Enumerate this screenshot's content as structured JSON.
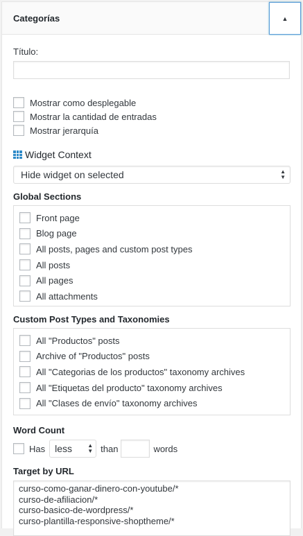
{
  "widget": {
    "title": "Categorías",
    "toggle_glyph": "▲"
  },
  "form": {
    "title_label": "Título:",
    "title_value": "",
    "options": [
      {
        "label": "Mostrar como desplegable",
        "checked": false
      },
      {
        "label": "Mostrar la cantidad de entradas",
        "checked": false
      },
      {
        "label": "Mostrar jerarquía",
        "checked": false
      }
    ]
  },
  "widget_context": {
    "heading": "Widget Context",
    "icon": "grid-table-icon",
    "icon_color": "#2e8ac8",
    "visibility_select": "Hide widget on selected",
    "global_sections": {
      "heading": "Global Sections",
      "items": [
        "Front page",
        "Blog page",
        "All posts, pages and custom post types",
        "All posts",
        "All pages",
        "All attachments"
      ]
    },
    "custom_types": {
      "heading": "Custom Post Types and Taxonomies",
      "items": [
        "All \"Productos\" posts",
        "Archive of \"Productos\" posts",
        "All \"Categorias de los productos\" taxonomy archives",
        "All \"Etiquetas del producto\" taxonomy archives",
        "All \"Clases de envío\" taxonomy archives"
      ]
    },
    "word_count": {
      "heading": "Word Count",
      "has_label": "Has",
      "comparison": "less",
      "than_label": "than",
      "count_value": "",
      "words_label": "words"
    },
    "target_url": {
      "heading": "Target by URL",
      "lines": [
        "curso-como-ganar-dinero-con-youtube/*",
        "curso-de-afiliacion/*",
        "curso-basico-de-wordpress/*",
        "curso-plantilla-responsive-shoptheme/*"
      ]
    }
  }
}
